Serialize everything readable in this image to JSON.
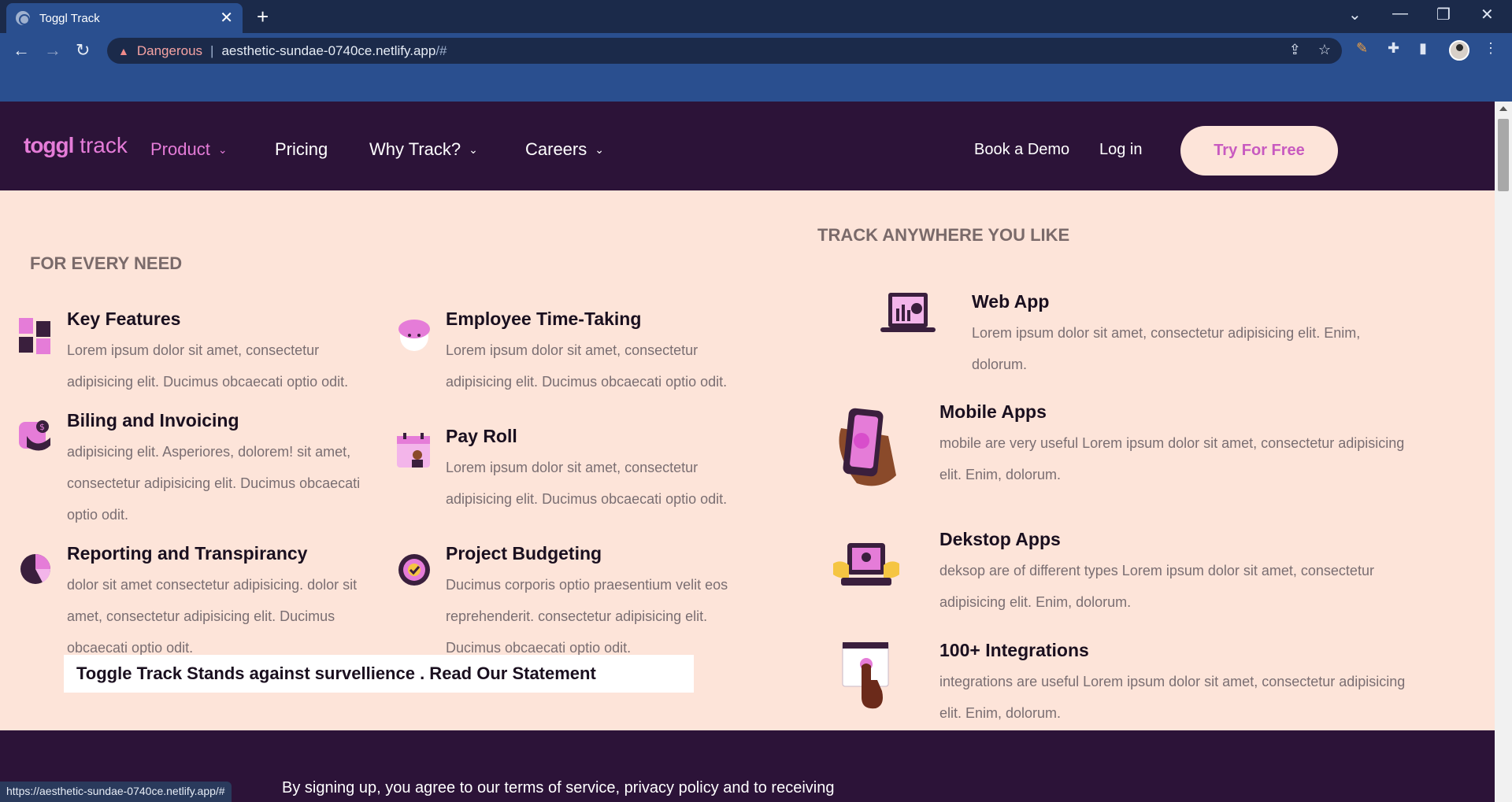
{
  "browser": {
    "tab_title": "Toggl Track",
    "tab_close": "✕",
    "new_tab": "+",
    "security_label": "Dangerous",
    "url_host": "aesthetic-sundae-0740ce.netlify.app",
    "url_hash": "/#",
    "status_url": "https://aesthetic-sundae-0740ce.netlify.app/#"
  },
  "header": {
    "logo_bold": "toggl",
    "logo_light": "track",
    "nav": [
      {
        "label": "Product",
        "active": true
      },
      {
        "label": "Pricing"
      },
      {
        "label": "Why Track?"
      },
      {
        "label": "Careers"
      }
    ],
    "book_demo": "Book a Demo",
    "login": "Log in",
    "cta": "Try For Free"
  },
  "panel": {
    "left_heading": "FOR EVERY NEED",
    "right_heading": "TRACK ANYWHERE YOU LIKE",
    "features": [
      {
        "title": "Key Features",
        "desc1": "Lorem ipsum dolor sit amet, consectetur",
        "desc2": "adipisicing elit. Ducimus obcaecati optio odit.",
        "desc3": "",
        "icon": "key-features-icon"
      },
      {
        "title": "Employee Time-Taking",
        "desc1": "Lorem ipsum dolor sit amet, consectetur",
        "desc2": "adipisicing elit. Ducimus obcaecati optio odit.",
        "desc3": "",
        "icon": "employee-icon"
      },
      {
        "title": "Biling and Invoicing",
        "desc1": "adipisicing elit. Asperiores, dolorem! sit amet,",
        "desc2": "consectetur adipisicing elit. Ducimus obcaecati",
        "desc3": "optio odit.",
        "icon": "invoice-icon"
      },
      {
        "title": "Pay Roll",
        "desc1": "Lorem ipsum dolor sit amet, consectetur",
        "desc2": "adipisicing elit. Ducimus obcaecati optio odit.",
        "desc3": "",
        "icon": "payroll-icon"
      },
      {
        "title": "Reporting and Transpirancy",
        "desc1": "dolor sit amet consectetur adipisicing. dolor sit",
        "desc2": "amet, consectetur adipisicing elit. Ducimus",
        "desc3": "obcaecati optio odit.",
        "icon": "pie-chart-icon"
      },
      {
        "title": "Project Budgeting",
        "desc1": "Ducimus corporis optio praesentium velit eos",
        "desc2": "reprehenderit. consectetur adipisicing elit.",
        "desc3": "Ducimus obcaecati optio odit.",
        "icon": "budget-icon"
      }
    ],
    "apps": [
      {
        "title": "Web App",
        "desc1": "Lorem ipsum dolor sit amet, consectetur adipisicing elit. Enim,",
        "desc2": "dolorum.",
        "icon": "laptop-icon"
      },
      {
        "title": "Mobile Apps",
        "desc1": "mobile are very useful Lorem ipsum dolor sit amet, consectetur adipisicing",
        "desc2": "elit. Enim, dolorum.",
        "icon": "phone-icon"
      },
      {
        "title": "Dekstop Apps",
        "desc1": "deksop are of different types Lorem ipsum dolor sit amet, consectetur",
        "desc2": "adipisicing elit. Enim, dolorum.",
        "icon": "desktop-icon"
      },
      {
        "title": "100+ Integrations",
        "desc1": "integrations are useful Lorem ipsum dolor sit amet, consectetur adipisicing",
        "desc2": "elit. Enim, dolorum.",
        "icon": "integration-icon"
      }
    ],
    "statement": "Toggle Track Stands against survellience . Read Our Statement"
  },
  "footer": {
    "text": "By signing up, you agree to our terms of service, privacy policy and to receiving"
  },
  "colors": {
    "accent": "#e57cd8",
    "header_bg": "#2c1338",
    "panel_bg": "#fde4d9"
  }
}
